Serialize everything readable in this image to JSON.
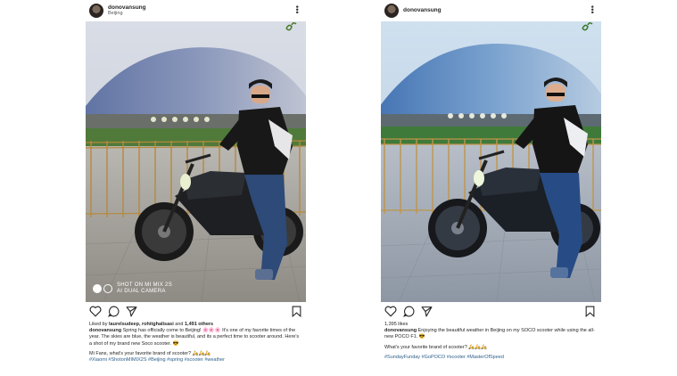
{
  "left_post": {
    "username": "donovansung",
    "location": "Beijing",
    "watermark": {
      "line1": "SHOT ON MI MIX 2S",
      "line2": "AI DUAL CAMERA"
    },
    "liked_by_prefix": "Liked by ",
    "liked_by_names": "laurelsudeep, rohitghalisasi",
    "liked_by_and": " and ",
    "liked_by_others": "1,491 others",
    "caption_user": "donovansung",
    "caption_text": "Spring has officially come to Beijing! 🌸🌸🌸 It's one of my favorite times of the year. The skies are blue, the weather is beautiful, and its a perfect time to scooter around.  Here's a shot of my brand new Soco scooter. 😎",
    "question": "Mi Fans, what's your favorite brand of scooter? 🛵🛵🛵",
    "hashtags": "#Xiaomi #ShotonMIMIX2S #Beijing #spring #scooter #weather"
  },
  "right_post": {
    "username": "donovansung",
    "likes": "1,395 likes",
    "caption_user": "donovansung",
    "caption_text": "Enjoying the beautiful weather in Beijing on my SOCO scooter while using the all-new POCO F1. 😎",
    "question": "What's your favorite brand of scooter? 🛵🛵🛵",
    "hashtags": "#SundayFunday #GoPOCO #scooter #MasterOfSpeed"
  },
  "icons": {
    "more": "more-options-icon",
    "like": "heart-icon",
    "comment": "comment-icon",
    "share": "share-icon",
    "save": "bookmark-icon"
  }
}
